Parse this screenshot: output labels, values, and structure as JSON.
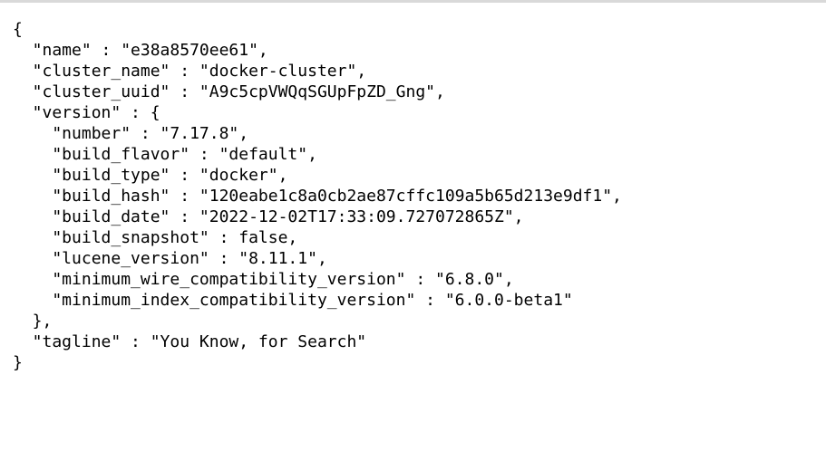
{
  "document": {
    "lines": [
      "{",
      "  \"name\" : \"e38a8570ee61\",",
      "  \"cluster_name\" : \"docker-cluster\",",
      "  \"cluster_uuid\" : \"A9c5cpVWQqSGUpFpZD_Gng\",",
      "  \"version\" : {",
      "    \"number\" : \"7.17.8\",",
      "    \"build_flavor\" : \"default\",",
      "    \"build_type\" : \"docker\",",
      "    \"build_hash\" : \"120eabe1c8a0cb2ae87cffc109a5b65d213e9df1\",",
      "    \"build_date\" : \"2022-12-02T17:33:09.727072865Z\",",
      "    \"build_snapshot\" : false,",
      "    \"lucene_version\" : \"8.11.1\",",
      "    \"minimum_wire_compatibility_version\" : \"6.8.0\",",
      "    \"minimum_index_compatibility_version\" : \"6.0.0-beta1\"",
      "  },",
      "  \"tagline\" : \"You Know, for Search\"",
      "}"
    ]
  }
}
